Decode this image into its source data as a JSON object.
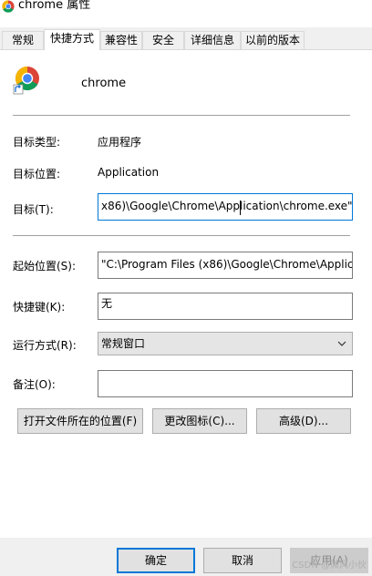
{
  "window": {
    "title": "chrome 属性"
  },
  "tabs": [
    {
      "label": "常规"
    },
    {
      "label": "快捷方式"
    },
    {
      "label": "兼容性"
    },
    {
      "label": "安全"
    },
    {
      "label": "详细信息"
    },
    {
      "label": "以前的版本"
    }
  ],
  "shortcut": {
    "name": "chrome",
    "target_type_label": "目标类型:",
    "target_type_value": "应用程序",
    "target_location_label": "目标位置:",
    "target_location_value": "Application",
    "target_label": "目标(T):",
    "target_value": "x86)\\Google\\Chrome\\Application\\chrome.exe\"",
    "start_in_label": "起始位置(S):",
    "start_in_value": "\"C:\\Program Files (x86)\\Google\\Chrome\\Applic",
    "hotkey_label": "快捷键(K):",
    "hotkey_value": "无",
    "run_label": "运行方式(R):",
    "run_value": "常规窗口",
    "comment_label": "备注(O):",
    "comment_value": ""
  },
  "buttons": {
    "open_location": "打开文件所在的位置(F)",
    "change_icon": "更改图标(C)...",
    "advanced": "高级(D)...",
    "ok": "确定",
    "cancel": "取消",
    "apply": "应用(A)"
  },
  "watermark": "CSDN @微风小伙"
}
